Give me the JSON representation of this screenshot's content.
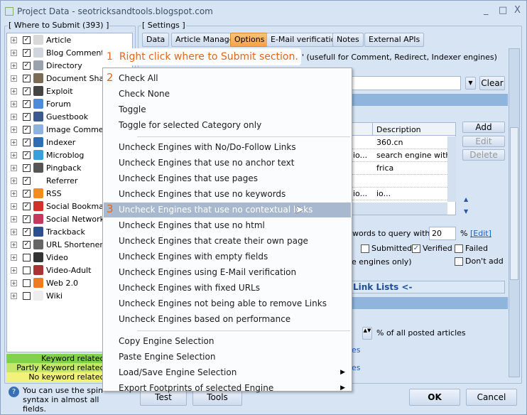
{
  "window": {
    "title": "Project Data - seotricksandtools.blogspot.com",
    "min": "_",
    "max": "□",
    "close": "X"
  },
  "tree": {
    "label": "[ Where to Submit  (393) ]",
    "items": [
      {
        "label": "Article",
        "checked": true,
        "icon": "article-icon",
        "color": "#d9d9d9"
      },
      {
        "label": "Blog Comment",
        "checked": true,
        "icon": "comment-icon",
        "color": "#cfd6de"
      },
      {
        "label": "Directory",
        "checked": true,
        "icon": "directory-icon",
        "color": "#9aa3ad"
      },
      {
        "label": "Document Sharing",
        "checked": true,
        "icon": "document-icon",
        "color": "#7a6c55"
      },
      {
        "label": "Exploit",
        "checked": true,
        "icon": "exploit-icon",
        "color": "#444"
      },
      {
        "label": "Forum",
        "checked": true,
        "icon": "forum-icon",
        "color": "#4c8cd8"
      },
      {
        "label": "Guestbook",
        "checked": true,
        "icon": "guestbook-icon",
        "color": "#3c5a8e"
      },
      {
        "label": "Image Comment",
        "checked": true,
        "icon": "image-icon",
        "color": "#8db4da"
      },
      {
        "label": "Indexer",
        "checked": true,
        "icon": "indexer-icon",
        "color": "#2f6db5"
      },
      {
        "label": "Microblog",
        "checked": true,
        "icon": "twitter-icon",
        "color": "#3aa0dc"
      },
      {
        "label": "Pingback",
        "checked": true,
        "icon": "pingback-icon",
        "color": "#555"
      },
      {
        "label": "Referrer",
        "checked": true,
        "icon": "referrer-icon",
        "color": "#fff"
      },
      {
        "label": "RSS",
        "checked": true,
        "icon": "rss-icon",
        "color": "#f28c1e"
      },
      {
        "label": "Social Bookmark",
        "checked": true,
        "icon": "bookmark-icon",
        "color": "#d2302a"
      },
      {
        "label": "Social Network",
        "checked": true,
        "icon": "network-icon",
        "color": "#c43a5c"
      },
      {
        "label": "Trackback",
        "checked": true,
        "icon": "trackback-icon",
        "color": "#2c4f8e"
      },
      {
        "label": "URL Shortener",
        "checked": true,
        "icon": "shortener-icon",
        "color": "#666"
      },
      {
        "label": "Video",
        "checked": false,
        "icon": "video-icon",
        "color": "#333"
      },
      {
        "label": "Video-Adult",
        "checked": false,
        "icon": "video-adult-icon",
        "color": "#a33"
      },
      {
        "label": "Web 2.0",
        "checked": false,
        "icon": "blogger-icon",
        "color": "#f07c22"
      },
      {
        "label": "Wiki",
        "checked": false,
        "icon": "wiki-icon",
        "color": "#eee"
      }
    ]
  },
  "legend": [
    {
      "label": "Keyword related Target",
      "color": "#7fd24a"
    },
    {
      "label": "Partly Keyword related Target",
      "color": "#c6e86a"
    },
    {
      "label": "No keyword related Target",
      "color": "#f2f27a"
    }
  ],
  "hint": "You can use the spin syntax in almost all fields.",
  "settings": {
    "label": "[ Settings ]",
    "tabs": [
      "Data",
      "Article Manager",
      "Options",
      "E-Mail verification",
      "Notes",
      "External APIs"
    ],
    "active_tab": "Options"
  },
  "options": {
    "useful_text": "' (usefull for Comment, Redirect, Indexer engines)",
    "clear": "Clear",
    "col_description": "Description",
    "rows": [
      "360.cn",
      "search engine with ju",
      "frica",
      "",
      "io..."
    ],
    "rows_left": [
      "",
      "io...",
      "",
      "",
      "io..."
    ],
    "add": "Add",
    "edit": "Edit",
    "delete": "Delete",
    "query_text": "words to query with",
    "query_value": "20",
    "percent": "%",
    "edit_link": "[Edit]",
    "submitted": "Submitted",
    "verified": "Verified",
    "failed": "Failed",
    "dont_add": "Don't add",
    "engines_only": "e engines only)",
    "link_lists": "Link Lists <-",
    "posted_text": "% of all posted articles",
    "es1": "es",
    "es2": "es"
  },
  "buttons": {
    "test": "Test",
    "tools": "Tools",
    "ok": "OK",
    "cancel": "Cancel"
  },
  "callout": {
    "num": "1",
    "text": "Right click where to Submit section."
  },
  "menu": {
    "items": [
      {
        "label": "Check All",
        "step": "2"
      },
      {
        "label": "Check None"
      },
      {
        "label": "Toggle"
      },
      {
        "label": "Toggle for selected Category only"
      },
      {
        "sep": true
      },
      {
        "label": "Uncheck Engines with No/Do-Follow Links"
      },
      {
        "label": "Uncheck Engines that use no anchor text"
      },
      {
        "label": "Uncheck Engines that use pages"
      },
      {
        "label": "Uncheck Engines that use no keywords"
      },
      {
        "label": "Uncheck Engines that use no contextual links",
        "step": "3",
        "highlight": true
      },
      {
        "label": "Uncheck Engines that use no html"
      },
      {
        "label": "Uncheck Engines that create their own page"
      },
      {
        "label": "Uncheck Engines with empty fields"
      },
      {
        "label": "Uncheck Engines using E-Mail verification"
      },
      {
        "label": "Uncheck Engines with fixed URLs"
      },
      {
        "label": "Uncheck Engines not being able to remove Links"
      },
      {
        "label": "Uncheck Engines based on performance"
      },
      {
        "sep": true
      },
      {
        "label": "Copy Engine Selection"
      },
      {
        "label": "Paste Engine Selection"
      },
      {
        "label": "Load/Save Engine Selection",
        "submenu": true
      },
      {
        "label": "Export Footprints of selected Engine",
        "submenu": true
      }
    ]
  }
}
